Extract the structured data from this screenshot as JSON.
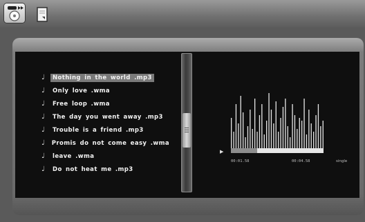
{
  "toolbar": {
    "buttons": [
      {
        "icon": "media-player-icon"
      },
      {
        "icon": "document-icon"
      }
    ]
  },
  "playlist": {
    "tracks": [
      {
        "name": "Nothing in the world .mp3",
        "selected": true
      },
      {
        "name": "Only love .wma"
      },
      {
        "name": "Free loop .wma"
      },
      {
        "name": "The day you went away .mp3"
      },
      {
        "name": "Trouble is a friend .mp3"
      },
      {
        "name": "Promis do not come easy .wma"
      },
      {
        "name": "leave .wma"
      },
      {
        "name": "Do not heat me .mp3"
      }
    ],
    "note_symbol": "♩"
  },
  "player": {
    "play_marker": "▶",
    "elapsed": "00:01.58",
    "total": "00:04.58",
    "mode": "single",
    "progress": 0.28,
    "spectrum_levels": [
      0.55,
      0.3,
      0.8,
      0.45,
      0.95,
      0.65,
      0.2,
      0.4,
      0.7,
      0.35,
      0.9,
      0.3,
      0.6,
      0.8,
      0.25,
      0.5,
      1.0,
      0.7,
      0.45,
      0.85,
      0.3,
      0.55,
      0.75,
      0.9,
      0.4,
      0.2,
      0.8,
      0.6,
      0.35,
      0.55,
      0.5,
      0.9,
      0.25,
      0.7,
      0.45,
      0.3,
      0.6,
      0.8,
      0.4,
      0.5
    ]
  }
}
